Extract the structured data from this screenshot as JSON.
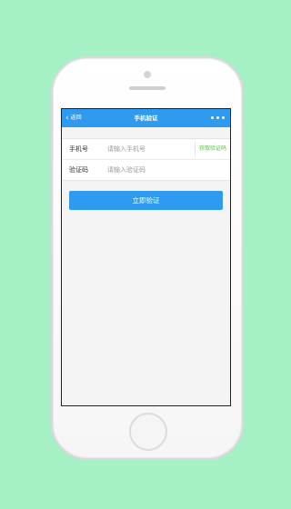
{
  "header": {
    "back_label": "返回",
    "back_icon": "chevron-left-icon",
    "title": "手机验证",
    "more_icon": "more-dots-icon"
  },
  "form": {
    "phone": {
      "label": "手机号",
      "placeholder": "请输入手机号",
      "value": ""
    },
    "code": {
      "label": "验证码",
      "placeholder": "请输入验证码",
      "value": ""
    },
    "get_code_label": "获取验证码",
    "submit_label": "立即验证"
  },
  "colors": {
    "background": "#a6f0c6",
    "accent": "#2e9bf1",
    "get_code": "#5fb94a"
  }
}
